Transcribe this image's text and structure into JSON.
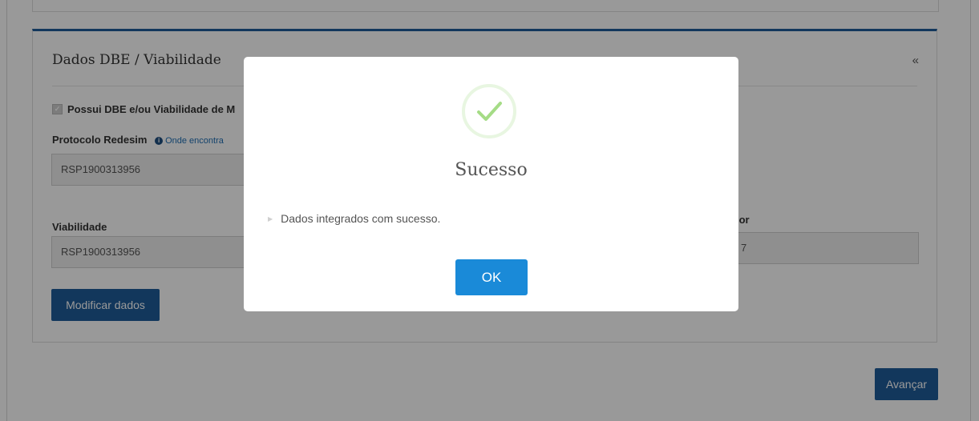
{
  "section": {
    "title": "Dados DBE / Viabilidade",
    "collapse_icon": "«",
    "checkbox_label": "Possui DBE e/ou Viabilidade de M",
    "protocolo_label": "Protocolo Redesim",
    "protocolo_help": "Onde encontra",
    "protocolo_value": "RSP1900313956",
    "viabilidade_label": "Viabilidade",
    "viabilidade_value": "RSP1900313956",
    "right_label": "lor",
    "right_value": "7",
    "modify_button": "Modificar dados"
  },
  "footer": {
    "advance_button": "Avançar"
  },
  "modal": {
    "icon": "check-icon",
    "title": "Sucesso",
    "message": "Dados integrados com sucesso.",
    "ok_button": "OK"
  },
  "colors": {
    "primary": "#1f5c99",
    "ok_button": "#1a8ad8",
    "success": "#a5dc86"
  }
}
